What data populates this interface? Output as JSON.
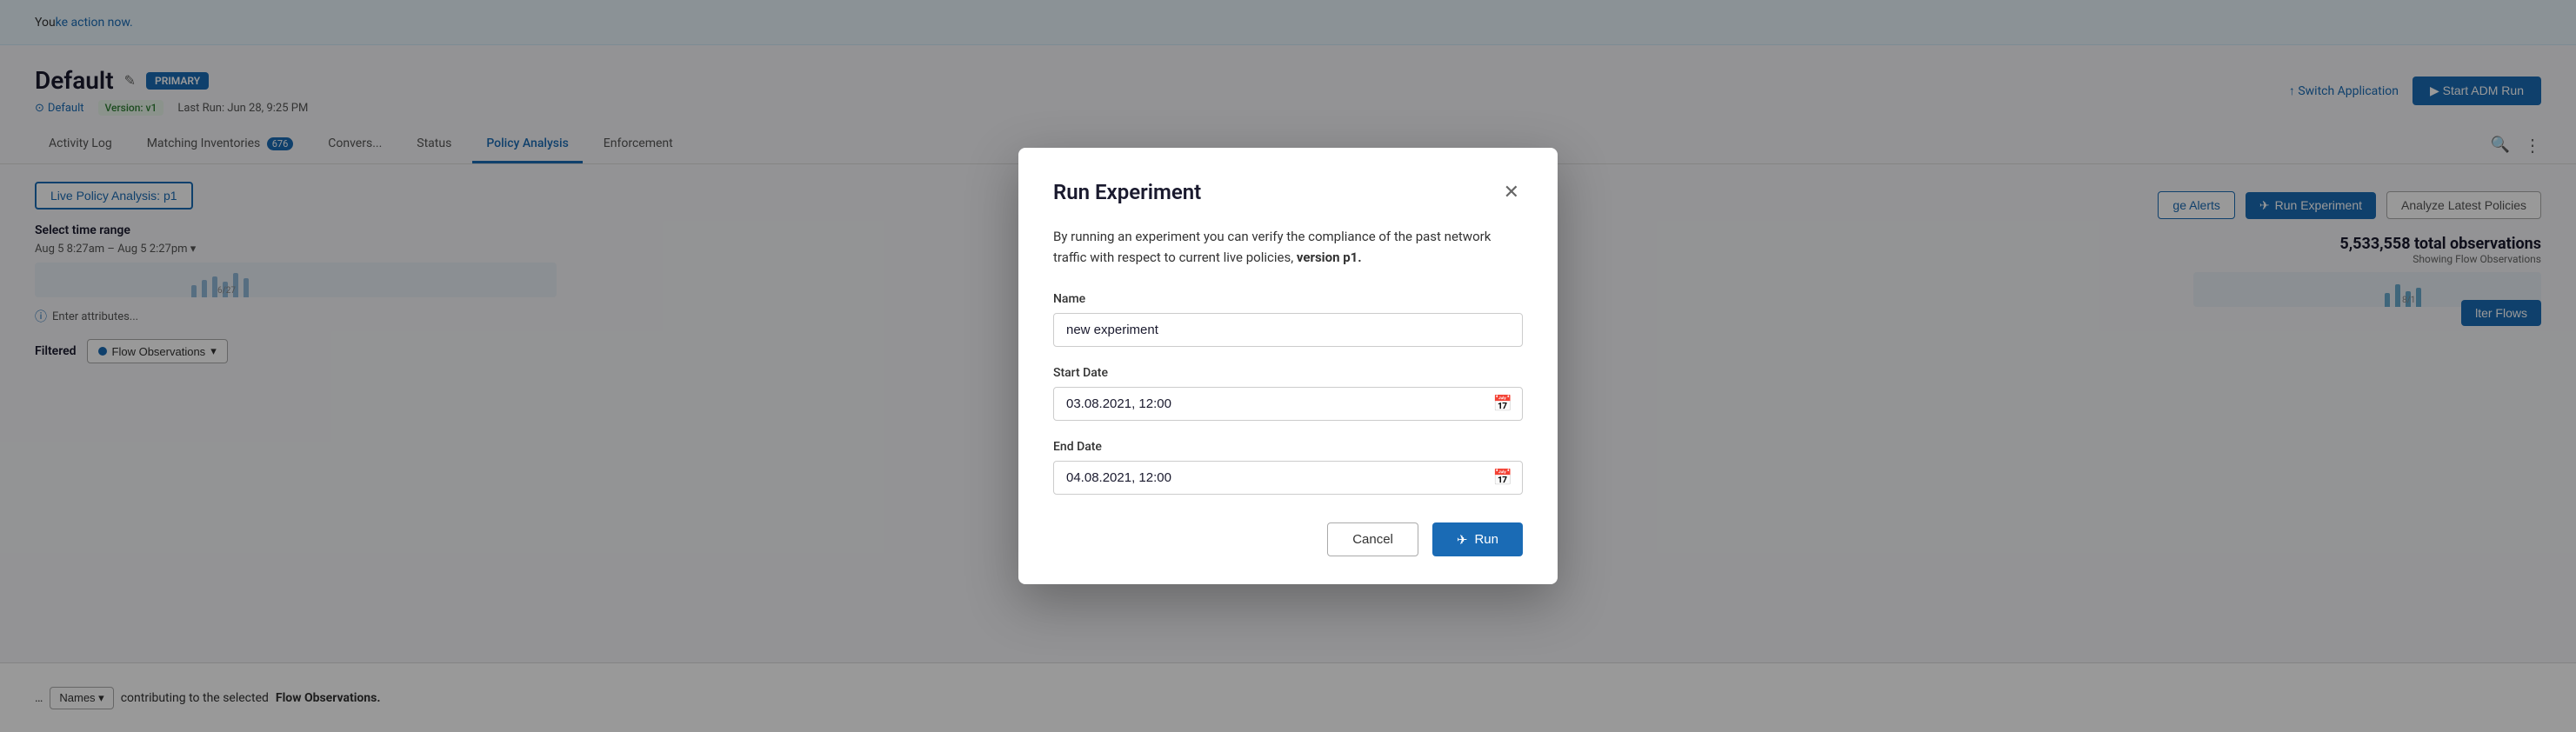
{
  "banner": {
    "text": "You "
  },
  "header": {
    "app_name": "Default",
    "primary_badge": "PRIMARY",
    "default_label": "Default",
    "version_label": "Version: v1",
    "last_run_label": "Last Run: Jun 28, 9:25 PM",
    "switch_app": "↑ Switch Application",
    "start_adm": "▶ Start ADM Run"
  },
  "tabs": [
    {
      "label": "Activity Log",
      "badge": null,
      "active": false
    },
    {
      "label": "Matching Inventories",
      "badge": "676",
      "active": false
    },
    {
      "label": "Convers...",
      "badge": null,
      "active": false
    },
    {
      "label": "Status",
      "badge": null,
      "active": false
    },
    {
      "label": "Policy Analysis",
      "badge": null,
      "active": true
    },
    {
      "label": "Enforcement",
      "badge": null,
      "active": false
    }
  ],
  "content": {
    "live_policy_btn": "Live Policy Analysis: p1",
    "time_range": {
      "label": "Select time range",
      "range_text": "Aug 5 8:27am – Aug 5 2:27pm ▾"
    },
    "enter_attrs": "Enter attributes...",
    "filter_label": "Filtered",
    "flow_obs_label": "Flow Observations",
    "flow_obs_chevron": "▾"
  },
  "right_panel": {
    "manage_alerts": "ge Alerts",
    "run_experiment": "Run Experiment",
    "analyze_latest": "Analyze Latest Policies",
    "obs_count": "5,533,558 total observations",
    "obs_subtitle": "Showing Flow Observations",
    "filter_flows": "lter Flows",
    "chart_label": "8/1",
    "names_dropdown": "Names ▾",
    "bottom_text": "contributing to the selected",
    "flow_obs_bold": "Flow Observations."
  },
  "modal": {
    "title": "Run Experiment",
    "description_before": "By running an experiment you can verify the compliance of the past network traffic with respect to current live policies, ",
    "version_bold": "version p1.",
    "name_label": "Name",
    "name_value": "new experiment",
    "start_date_label": "Start Date",
    "start_date_value": "03.08.2021, 12:00",
    "end_date_label": "End Date",
    "end_date_value": "04.08.2021, 12:00",
    "cancel_label": "Cancel",
    "run_label": "Run",
    "close_icon": "✕"
  },
  "colors": {
    "primary": "#1a6bb5",
    "bg": "#f5f6f8",
    "badge_bg": "#1a6bb5"
  }
}
